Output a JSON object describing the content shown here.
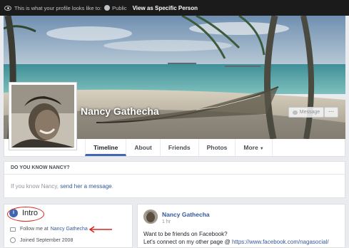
{
  "viewas_bar": {
    "message": "This is what your profile looks like to:",
    "audience": "Public",
    "view_as_button": "View as Specific Person"
  },
  "profile": {
    "name": "Nancy Gathecha",
    "message_button": "Message",
    "more_button": "···"
  },
  "tabs": [
    {
      "label": "Timeline",
      "active": true
    },
    {
      "label": "About"
    },
    {
      "label": "Friends"
    },
    {
      "label": "Photos"
    },
    {
      "label": "More",
      "caret": "▼"
    }
  ],
  "know_card": {
    "heading": "DO YOU KNOW NANCY?",
    "text_before": "If you know Nancy,",
    "link": "send her a message",
    "text_after": "."
  },
  "intro": {
    "title": "Intro",
    "follow_prefix": "Follow me at",
    "follow_link": "Nancy Gathecha",
    "joined": "Joined September 2008"
  },
  "post": {
    "author": "Nancy Gathecha",
    "time": "1 hr",
    "line1": "Want to be friends on Facebook?",
    "line2_prefix": "Let's connect on my other page @",
    "line2_link": "https://www.facebook.com/nagasocial/"
  },
  "colors": {
    "brand": "#4267b2",
    "link": "#365899",
    "annotation": "#d8261d"
  }
}
